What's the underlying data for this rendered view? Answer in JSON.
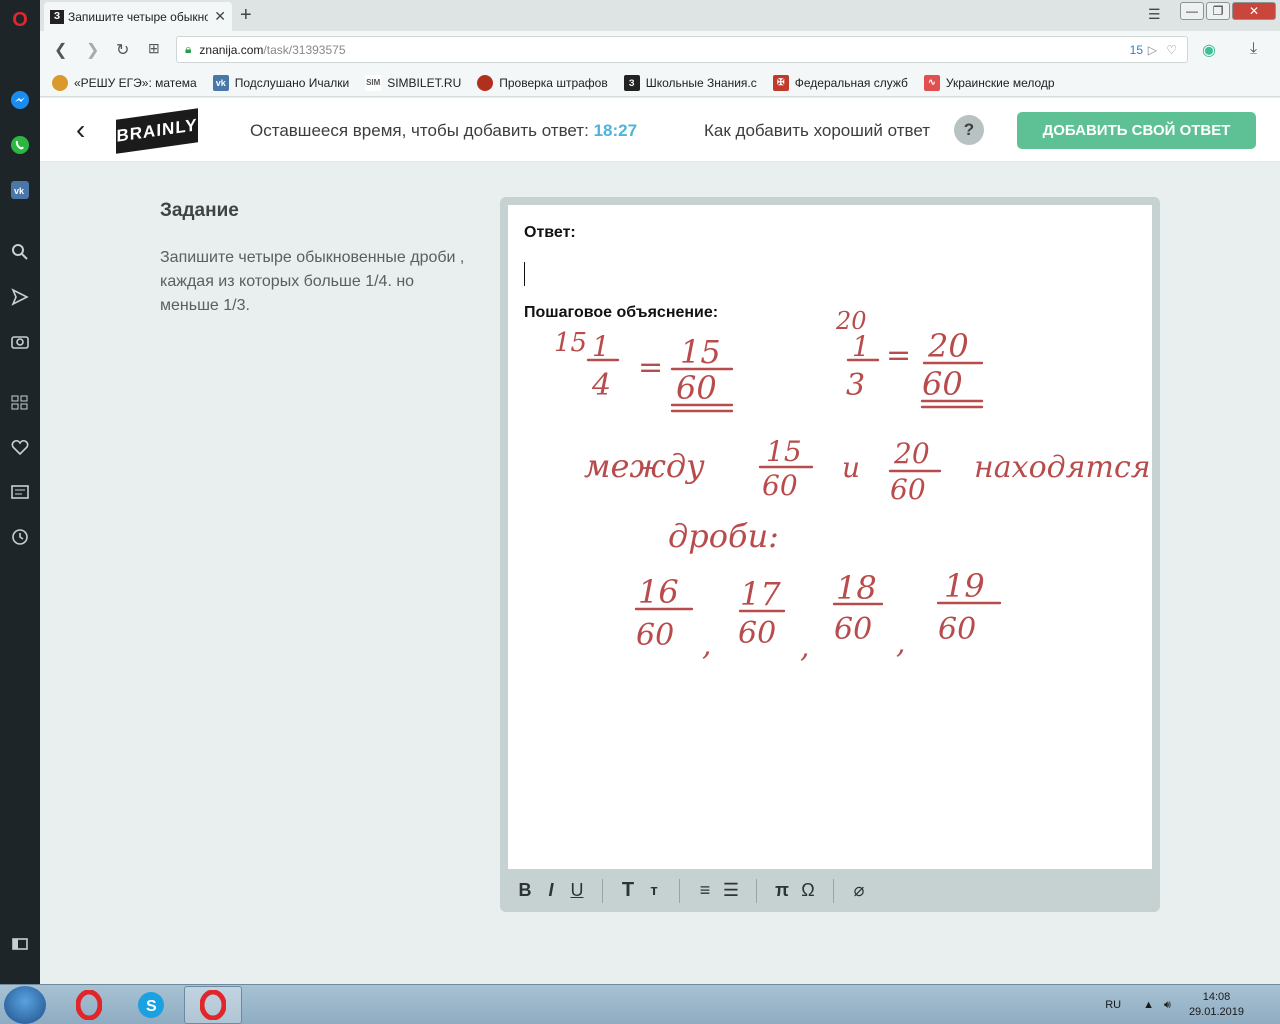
{
  "browser": {
    "tab_title": "Запишите четыре обыкновенные",
    "tab_favicon": "З",
    "new_tab": "+",
    "url_host": "znanija.com",
    "url_path": "/task/31393575",
    "ad_count": "15"
  },
  "bookmarks": [
    {
      "label": "«РЕШУ ЕГЭ»: матема",
      "icon": "sun-icon",
      "color": "#d99a2b"
    },
    {
      "label": "Подслушано Ичалки",
      "icon": "vk-icon",
      "color": "#4a76a8"
    },
    {
      "label": "SIMBILET.RU",
      "icon": "sim-icon",
      "color": "#555555"
    },
    {
      "label": "Проверка штрафов",
      "icon": "police-icon",
      "color": "#b03020"
    },
    {
      "label": "Школьные Знания.c",
      "icon": "znanija-icon",
      "color": "#222222"
    },
    {
      "label": "Федеральная служб",
      "icon": "emblem-icon",
      "color": "#c0392b"
    },
    {
      "label": "Украинские мелодр",
      "icon": "wave-icon",
      "color": "#e05050"
    }
  ],
  "header": {
    "logo": "BRAINLY",
    "timer_label": "Оставшееся время, чтобы добавить ответ:",
    "timer_value": "18:27",
    "howto_label": "Как добавить хороший ответ",
    "help": "?",
    "add_button": "ДОБАВИТЬ СВОЙ ОТВЕТ"
  },
  "task": {
    "heading": "Задание",
    "text": "Запишите четыре обыкновенные дроби , каждая из которых больше 1/4. но меньше 1/3."
  },
  "editor": {
    "answer_label": "Ответ:",
    "explanation_label": "Пошаговое объяснение:",
    "handwriting": {
      "color": "#b84b4b",
      "line1": {
        "mult_a": "15",
        "frac_a": [
          "1",
          "4"
        ],
        "eq_a": "=",
        "res_a": [
          "15",
          "60"
        ],
        "mult_b": "20",
        "frac_b": [
          "1",
          "3"
        ],
        "eq_b": "=",
        "res_b": [
          "20",
          "60"
        ]
      },
      "line2": {
        "w1": "между",
        "f1": [
          "15",
          "60"
        ],
        "w2": "и",
        "f2": [
          "20",
          "60"
        ],
        "w3": "находятся"
      },
      "line3": "дроби:",
      "answers": [
        [
          "16",
          "60"
        ],
        [
          "17",
          "60"
        ],
        [
          "18",
          "60"
        ],
        [
          "19",
          "60"
        ]
      ],
      "comma": ","
    },
    "toolbar": {
      "bold": "B",
      "italic": "I",
      "underline": "U",
      "text_big": "T",
      "text_small": "т",
      "ordered": "≡",
      "bullets": "☰",
      "pi": "π",
      "omega": "Ω",
      "attach": "⌀"
    }
  },
  "taskbar": {
    "lang": "RU",
    "time": "14:08",
    "date": "29.01.2019"
  }
}
